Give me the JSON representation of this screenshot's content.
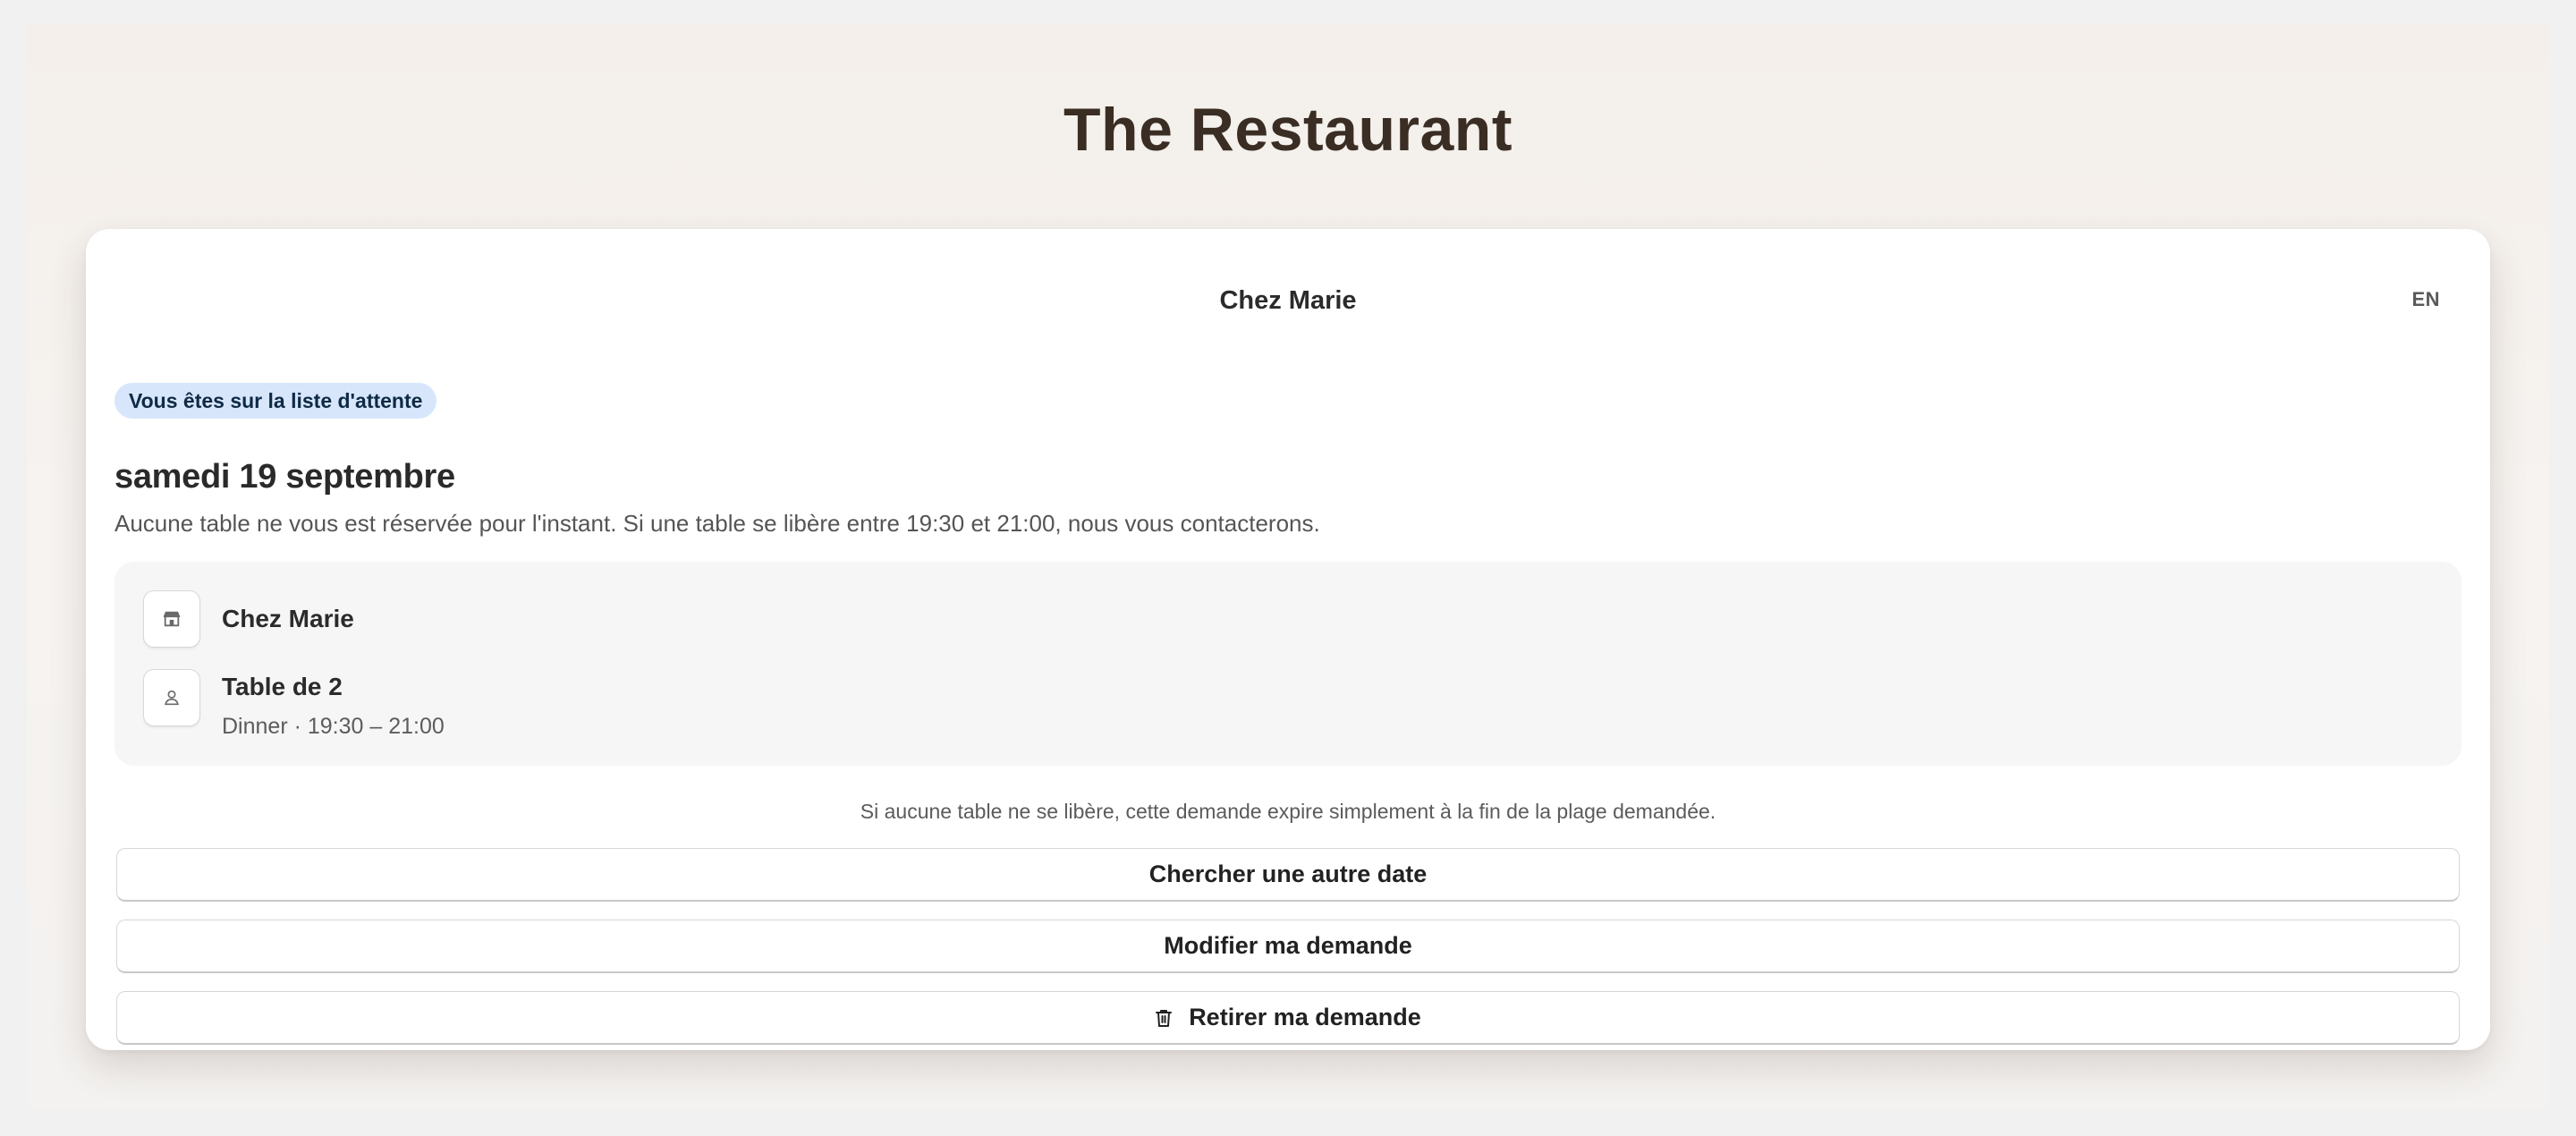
{
  "site": {
    "title": "The Restaurant"
  },
  "card": {
    "header_title": "Chez Marie",
    "language_toggle": "EN",
    "status_badge": "Vous êtes sur la liste d'attente",
    "date": "samedi 19 septembre",
    "description": "Aucune table ne vous est réservée pour l'instant. Si une table se libère entre 19:30 et 21:00, nous vous contacterons."
  },
  "details": {
    "restaurant": {
      "name": "Chez Marie",
      "icon": "storefront-icon"
    },
    "booking": {
      "title": "Table de 2",
      "subtitle": "Dinner · 19:30 – 21:00",
      "icon": "person-icon"
    }
  },
  "note": "Si aucune table ne se libère, cette demande expire simplement à la fin de la plage demandée.",
  "actions": {
    "search_other_date": "Chercher une autre date",
    "modify_request": "Modifier ma demande",
    "withdraw_request": "Retirer ma demande",
    "withdraw_icon": "trash-icon"
  },
  "colors": {
    "badge_bg": "#d7e6fb",
    "badge_text": "#0f2a45",
    "title_color": "#3a2d24"
  }
}
